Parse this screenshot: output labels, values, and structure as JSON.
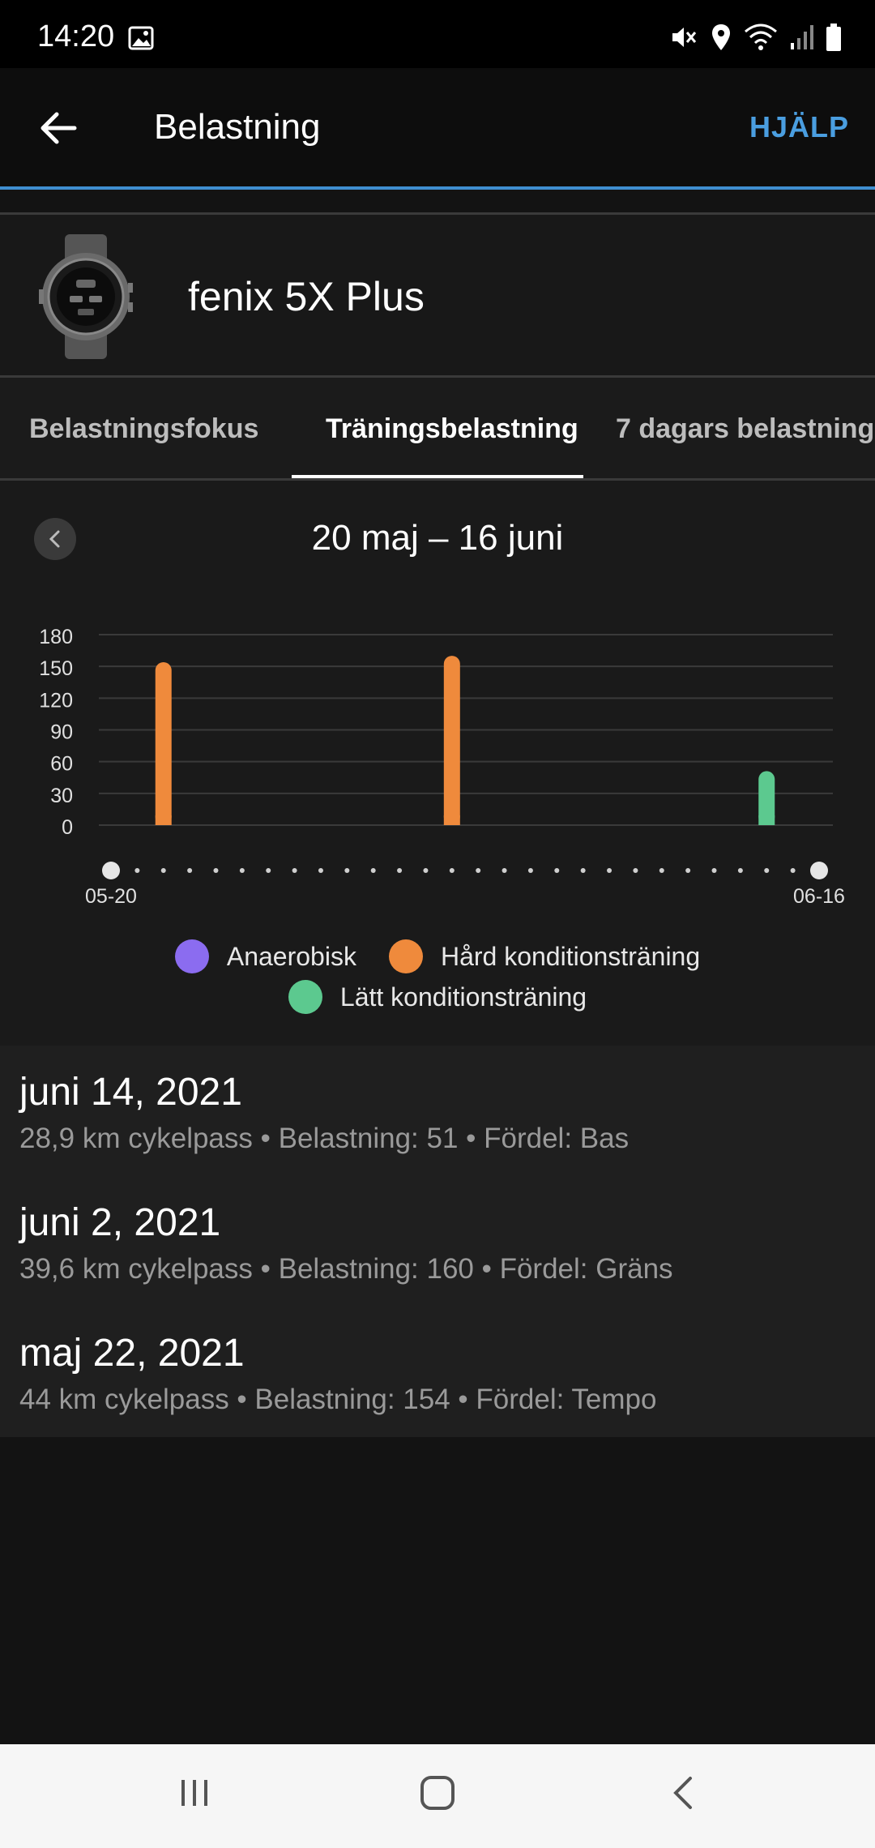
{
  "status_bar": {
    "time": "14:20"
  },
  "app_bar": {
    "title": "Belastning",
    "help_label": "HJÄLP"
  },
  "device": {
    "name": "fenix 5X Plus"
  },
  "tabs": [
    {
      "label": "Belastningsfokus",
      "active": false
    },
    {
      "label": "Träningsbelastning",
      "active": true
    },
    {
      "label": "7 dagars belastning",
      "active": false
    }
  ],
  "date_range": "20 maj – 16 juni",
  "chart_data": {
    "type": "bar",
    "title": "",
    "y_ticks": [
      "180",
      "150",
      "120",
      "90",
      "60",
      "30",
      "0"
    ],
    "ylim": [
      0,
      180
    ],
    "x_start_label": "05-20",
    "x_end_label": "06-16",
    "day_count": 28,
    "bars": [
      {
        "day": 3,
        "value": 154,
        "series": "Hård konditionsträning"
      },
      {
        "day": 14,
        "value": 160,
        "series": "Hård konditionsträning"
      },
      {
        "day": 26,
        "value": 51,
        "series": "Lätt konditionsträning"
      }
    ],
    "legend": [
      {
        "name": "Anaerobisk",
        "color": "#8b6cf0"
      },
      {
        "name": "Hård konditionsträning",
        "color": "#ef8a3c"
      },
      {
        "name": "Lätt konditionsträning",
        "color": "#5cc98f"
      }
    ],
    "grid": true
  },
  "activities": [
    {
      "date": "juni 14, 2021",
      "detail": "28,9 km cykelpass • Belastning: 51 • Fördel: Bas"
    },
    {
      "date": "juni 2, 2021",
      "detail": "39,6 km cykelpass • Belastning: 160 • Fördel: Gräns"
    },
    {
      "date": "maj 22, 2021",
      "detail": "44 km cykelpass • Belastning: 154 • Fördel: Tempo"
    }
  ]
}
